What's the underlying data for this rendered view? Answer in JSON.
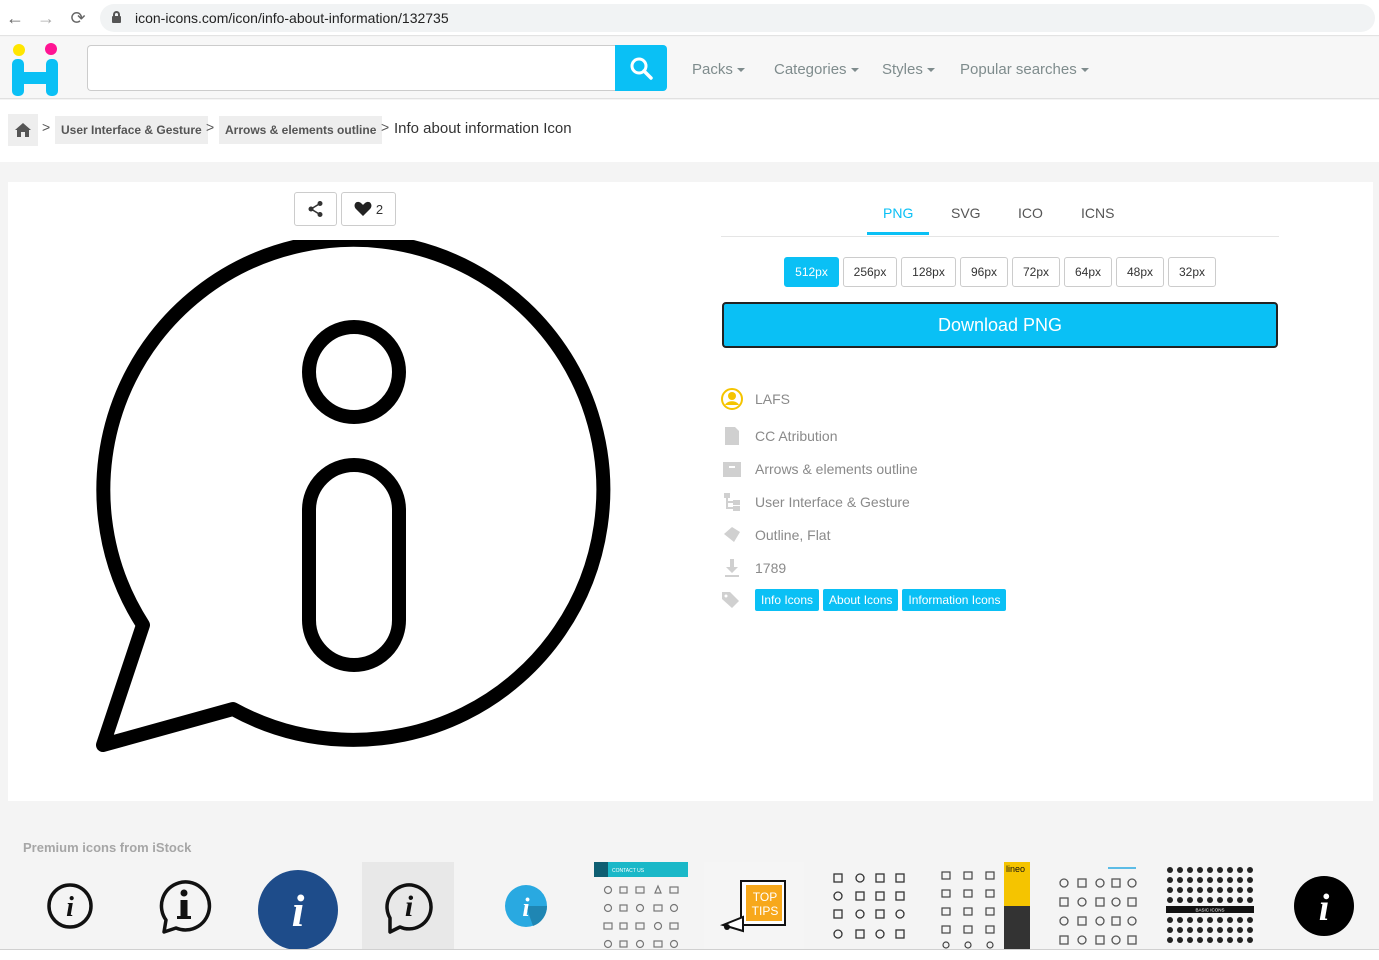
{
  "browser": {
    "url": "icon-icons.com/icon/info-about-information/132735"
  },
  "header": {
    "search_placeholder": "",
    "menu": [
      {
        "label": "Packs"
      },
      {
        "label": "Categories"
      },
      {
        "label": "Styles"
      },
      {
        "label": "Popular searches"
      }
    ]
  },
  "breadcrumb": {
    "items": [
      "User Interface & Gesture",
      "Arrows & elements outline"
    ],
    "current": "Info about information Icon"
  },
  "actions": {
    "likes": "2"
  },
  "formats": {
    "tabs": [
      "PNG",
      "SVG",
      "ICO",
      "ICNS"
    ],
    "active": "PNG",
    "sizes": [
      "512px",
      "256px",
      "128px",
      "96px",
      "72px",
      "64px",
      "48px",
      "32px"
    ],
    "active_size": "512px",
    "download_label": "Download PNG"
  },
  "meta": {
    "author": "LAFS",
    "license": "CC Atribution",
    "pack": "Arrows & elements outline",
    "category": "User Interface & Gesture",
    "styles": "Outline, Flat",
    "downloads": "1789",
    "tags": [
      "Info Icons",
      "About Icons",
      "Information Icons"
    ]
  },
  "colors": {
    "accent": "#0ac0f5",
    "logo_yellow": "#ffe600",
    "logo_pink": "#ff1493"
  },
  "premium": {
    "title": "Premium icons from iStock",
    "thumb_texts": {
      "contact": "CONTACT US",
      "tips_top": "TOP",
      "tips_bottom": "TIPS",
      "lineo": "lineo",
      "basic": "BASIC ICONS"
    }
  }
}
